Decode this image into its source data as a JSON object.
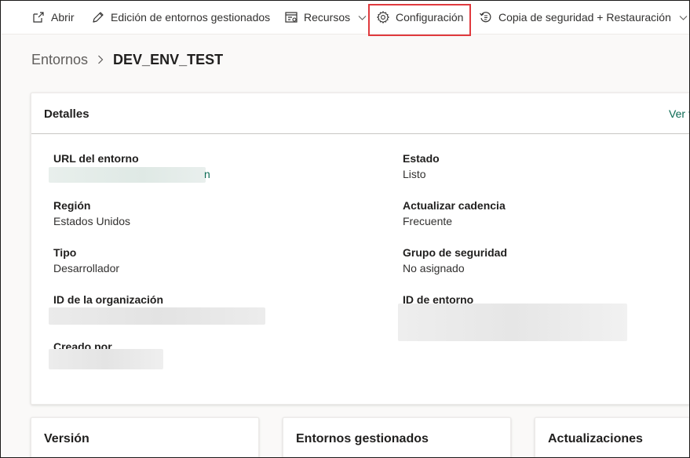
{
  "command_bar": {
    "items": [
      {
        "label": "Abrir",
        "icon": "open-external-icon"
      },
      {
        "label": "Edición de entornos gestionados",
        "icon": "pencil-icon"
      },
      {
        "label": "Recursos",
        "icon": "resources-icon",
        "dropdown": true
      },
      {
        "label": "Configuración",
        "icon": "gear-icon",
        "highlighted": true
      },
      {
        "label": "Copia de seguridad + Restauración",
        "icon": "backup-restore-icon",
        "dropdown": true
      }
    ]
  },
  "breadcrumb": {
    "root": "Entornos",
    "current": "DEV_ENV_TEST"
  },
  "details": {
    "title": "Detalles",
    "link": "Ver t",
    "fields": [
      {
        "label": "URL del entorno",
        "value": "n",
        "redacted": true
      },
      {
        "label": "Estado",
        "value": "Listo"
      },
      {
        "label": "Región",
        "value": "Estados Unidos"
      },
      {
        "label": "Actualizar cadencia",
        "value": "Frecuente"
      },
      {
        "label": "Tipo",
        "value": "Desarrollador"
      },
      {
        "label": "Grupo de seguridad",
        "value": "No asignado"
      },
      {
        "label": "ID de la organización",
        "value": "",
        "redacted": true
      },
      {
        "label": "ID de entorno",
        "value": "",
        "redacted": true
      },
      {
        "label": "Creado por",
        "value": "",
        "redacted": true
      }
    ]
  },
  "bottom_cards": [
    {
      "title": "Versión"
    },
    {
      "title": "Entornos gestionados"
    },
    {
      "title": "Actualizaciones"
    }
  ],
  "colors": {
    "highlight": "#e03a3e",
    "link": "#0b6a53",
    "background": "#faf9f8"
  }
}
